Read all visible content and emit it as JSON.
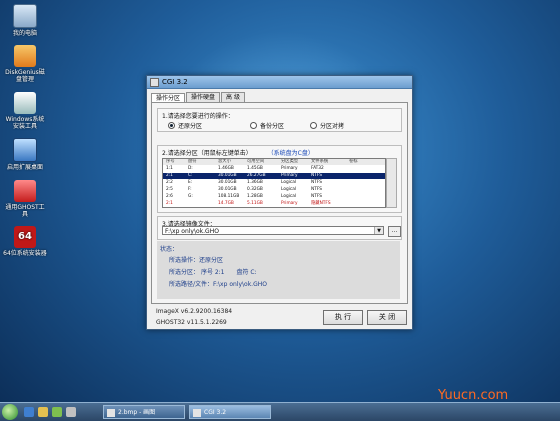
{
  "desktop": {
    "icons": [
      {
        "label": "我的电脑",
        "icon": "computer-icon"
      },
      {
        "label": "DiskGenius磁盘管理",
        "icon": "diskgenius-icon"
      },
      {
        "label": "Windows系统安装工具",
        "icon": "windows-install-icon"
      },
      {
        "label": "启用扩展桌面",
        "icon": "monitor-icon"
      },
      {
        "label": "通用GHOST工具",
        "icon": "ghost-icon"
      },
      {
        "label": "64位系统安装器",
        "icon": "x64-icon"
      }
    ]
  },
  "dialog": {
    "title": "CGI 3.2",
    "tabs": [
      "操作分区",
      "操作硬盘",
      "高 级"
    ],
    "step1": {
      "label": "1.请选择您要进行的操作：",
      "options": [
        "还原分区",
        "备份分区",
        "分区对拷"
      ],
      "selected": "还原分区"
    },
    "step2": {
      "label": "2.请选择分区（用鼠标左键单击）",
      "hint": "（系统盘为C盘）",
      "columns": [
        "序号",
        "盘符",
        "总大小",
        "可用空间",
        "分区类型",
        "文件系统",
        "卷标"
      ],
      "rows": [
        {
          "no": "1:1",
          "drive": "D:",
          "total": "1.46GB",
          "free": "1.45GB",
          "type": "Primary",
          "fs": "FAT32",
          "label": "",
          "selected": false
        },
        {
          "no": "2:1",
          "drive": "C:",
          "total": "30.01GB",
          "free": "26.27GB",
          "type": "Primary",
          "fs": "NTFS",
          "label": "",
          "selected": true
        },
        {
          "no": "2:2",
          "drive": "E:",
          "total": "30.01GB",
          "free": "1.36GB",
          "type": "Logical",
          "fs": "NTFS",
          "label": "",
          "selected": false
        },
        {
          "no": "2:5",
          "drive": "F:",
          "total": "30.01GB",
          "free": "0.32GB",
          "type": "Logical",
          "fs": "NTFS",
          "label": "",
          "selected": false
        },
        {
          "no": "2:6",
          "drive": "G:",
          "total": "108.11GB",
          "free": "1.28GB",
          "type": "Logical",
          "fs": "NTFS",
          "label": "",
          "selected": false
        },
        {
          "no": "2:1",
          "drive": "",
          "total": "14.7GB",
          "free": "5.11GB",
          "type": "Primary",
          "fs": "隐藏NTFS",
          "label": "",
          "selected": false,
          "warn": true
        }
      ]
    },
    "step3": {
      "label": "3.请选择镜像文件：",
      "value": "F:\\xp only\\ok.GHO",
      "browse_label": "..."
    },
    "status": {
      "title": "状态：",
      "operation_label": "所选操作：",
      "operation_value": "还原分区",
      "partition_label": "所选分区：",
      "partition_value": "序号 2:1",
      "drive_label": "盘符 C:",
      "path_label": "所选路径/文件：",
      "path_value": "F:\\xp only\\ok.GHO"
    },
    "footer": {
      "imagex": "ImageX v6.2.9200.16384",
      "ghost": "GHOST32 v11.5.1.2269"
    },
    "buttons": {
      "execute": "执 行",
      "close": "关 闭"
    }
  },
  "taskbar": {
    "tasks": [
      {
        "label": "2.bmp - 画图",
        "active": false
      },
      {
        "label": "CGI 3.2",
        "active": true
      }
    ]
  },
  "watermark": "Yuucn.com"
}
